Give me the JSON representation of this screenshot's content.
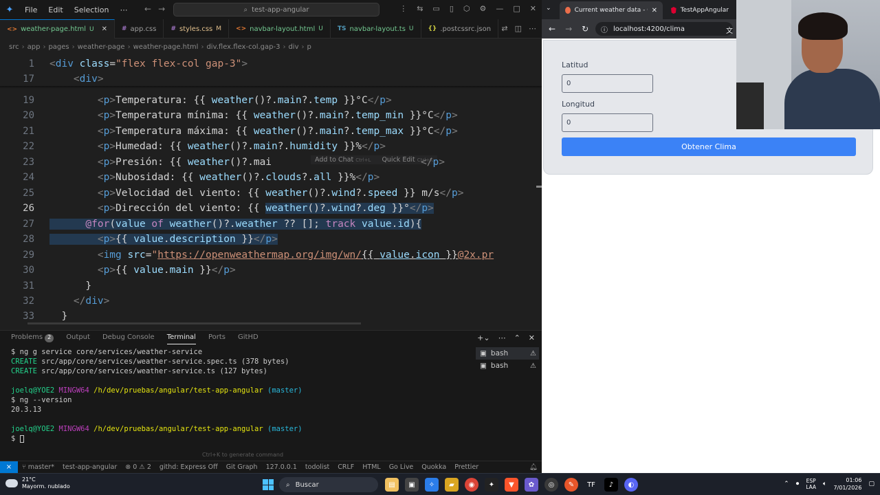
{
  "vscode": {
    "menu": [
      "File",
      "Edit",
      "Selection",
      "⋯"
    ],
    "search": "test-app-angular",
    "tabs": [
      {
        "icon": "<>",
        "name": "weather-page.html",
        "mod": "U",
        "active": true
      },
      {
        "icon": "#",
        "name": "app.css",
        "mod": "",
        "active": false
      },
      {
        "icon": "#",
        "name": "styles.css",
        "mod": "M",
        "active": false
      },
      {
        "icon": "<>",
        "name": "navbar-layout.html",
        "mod": "U",
        "active": false
      },
      {
        "icon": "TS",
        "name": "navbar-layout.ts",
        "mod": "U",
        "active": false
      },
      {
        "icon": "{}",
        "name": ".postcssrc.json",
        "mod": "",
        "active": false
      }
    ],
    "breadcrumb": [
      "src",
      "app",
      "pages",
      "weather-page",
      "weather-page.html",
      "div.flex.flex-col.gap-3",
      "div",
      "p"
    ],
    "inline_hint": {
      "add": "Add to Chat",
      "add_key": "Ctrl+L",
      "edit": "Quick Edit",
      "edit_key": "Ctrl+K"
    },
    "panel_tabs": [
      "Problems",
      "Output",
      "Debug Console",
      "Terminal",
      "Ports",
      "GitHD"
    ],
    "problems_count": "2",
    "terminal": {
      "l1": "$ ng g service core/services/weather-service",
      "l2a": "CREATE",
      "l2b": " src/app/core/services/weather-service.spec.ts (378 bytes)",
      "l3a": "CREATE",
      "l3b": " src/app/core/services/weather-service.ts (127 bytes)",
      "p_user": "joelq@YOE2",
      "p_sys": " MINGW64 ",
      "p_path": "/h/dev/pruebas/angular/test-app-angular",
      "p_branch": " (master)",
      "l5": "$ ng --version",
      "l6": "20.3.13",
      "l9": "$ "
    },
    "terminal_list": [
      "bash",
      "bash"
    ],
    "generate_hint": "Ctrl+K to generate command",
    "status": {
      "branch": "master*",
      "project": "test-app-angular",
      "problems": "⊗ 0 ⚠ 2",
      "githd": "githd: Express Off",
      "gitgraph": "Git Graph",
      "ip": "127.0.0.1",
      "todolist": "todolist",
      "eol": "CRLF",
      "lang": "HTML",
      "golive": "Go Live",
      "quokka": "Quokka",
      "prettier": "Prettier"
    }
  },
  "browser": {
    "tabs": [
      {
        "title": "Current weather data - OpenW"
      },
      {
        "title": "TestAppAngular"
      }
    ],
    "url": "localhost:4200/clima",
    "form": {
      "lat_label": "Latitud",
      "lat_value": "0",
      "lon_label": "Longitud",
      "lon_value": "0",
      "button": "Obtener Clima"
    }
  },
  "taskbar": {
    "temp": "21°C",
    "condition": "Mayorm. nublado",
    "search": "Buscar",
    "lang1": "ESP",
    "lang2": "LAA",
    "time": "01:06",
    "date": "7/01/2026"
  },
  "colors": {
    "accent": "#0078d4",
    "button": "#3b82f6"
  }
}
